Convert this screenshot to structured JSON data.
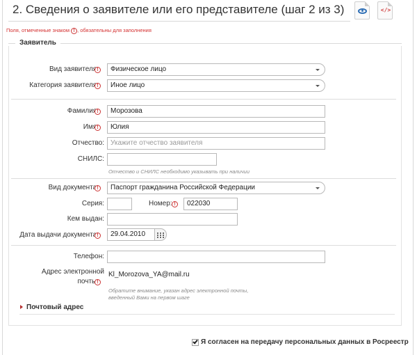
{
  "header": {
    "title": "2. Сведения о заявителе или его представителе (шаг 2 из 3)",
    "code_icon_text": "</>"
  },
  "required_note": {
    "before": "Поля, отмеченные знаком",
    "after": "обязательны для заполнения",
    "mark": "!"
  },
  "applicant": {
    "legend": "Заявитель",
    "type": {
      "label": "Вид заявителя:",
      "value": "Физическое лицо"
    },
    "category": {
      "label": "Категория заявителя:",
      "value": "Иное лицо"
    },
    "last_name": {
      "label": "Фамилия:",
      "value": "Морозова"
    },
    "first_name": {
      "label": "Имя:",
      "value": "Юлия"
    },
    "patronymic": {
      "label": "Отчество:",
      "placeholder": "Укажите отчество заявителя"
    },
    "snils": {
      "label": "СНИЛС:",
      "value": ""
    },
    "snils_hint": "Отчество и СНИЛС необходимо указывать при наличии",
    "doc_type": {
      "label": "Вид документа:",
      "value": "Паспорт гражданина Российской Федерации"
    },
    "series": {
      "label": "Серия:",
      "value": ""
    },
    "number": {
      "label": "Номер:",
      "value": "022030"
    },
    "issued_by": {
      "label": "Кем выдан:",
      "value": ""
    },
    "issue_date": {
      "label": "Дата выдачи документа:",
      "value": "29.04.2010"
    },
    "phone": {
      "label": "Телефон:",
      "value": ""
    },
    "email": {
      "label_line1": "Адрес электронной",
      "label_line2": "почты:",
      "value": "Kl_Morozova_YA@mail.ru"
    },
    "email_hint_line1": "Обратите внимание, указан адрес электронной почты,",
    "email_hint_line2": "введенный Вами на первом шаге",
    "postal_address": "Почтовый адрес"
  },
  "consent": {
    "label": "Я согласен на передачу персональных данных в Росреестр",
    "checked": true
  },
  "colors": {
    "required": "#cc3333",
    "border": "#b8b8b8",
    "eye_icon": "#2f6fb5",
    "code_icon": "#d04040"
  }
}
